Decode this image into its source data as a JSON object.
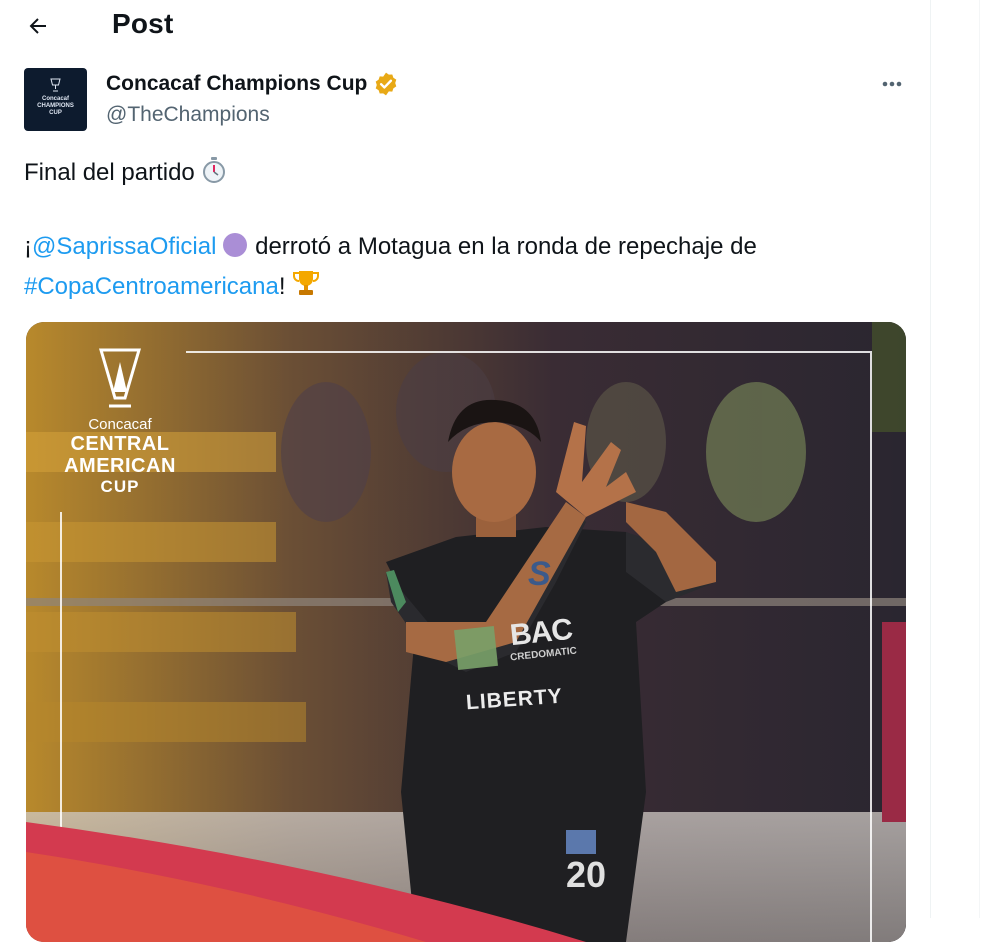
{
  "header": {
    "back_icon": "arrow-left-icon",
    "title": "Post"
  },
  "author": {
    "avatar_lines": [
      "Concacaf",
      "CHAMPIONS",
      "CUP"
    ],
    "display_name": "Concacaf Champions Cup",
    "verified_icon": "verified-badge-icon",
    "verified_color": "#f4b400",
    "handle": "@TheChampions",
    "more_icon": "more-horizontal-icon"
  },
  "tweet": {
    "line1_text": "Final del partido",
    "line1_emoji": "stopwatch-icon",
    "line2_prefix": "¡",
    "mention": "@SaprissaOficial",
    "purple_circle_emoji": "purple-circle-icon",
    "line2_rest": "derrotó a Motagua en la ronda de repechaje de",
    "hashtag": "#CopaCentroamericana",
    "line3_suffix": "!",
    "trophy_emoji": "trophy-icon",
    "link_color": "#1d9bf0"
  },
  "media": {
    "logo_small": "Concacaf",
    "logo_line1": "CENTRAL",
    "logo_line2": "AMERICAN",
    "logo_line3": "CUP",
    "jersey_sponsor": "BAC",
    "jersey_sub": "CREDOMATIC",
    "jersey_brand": "LIBERTY",
    "jersey_crest": "S",
    "jersey_number": "20"
  }
}
